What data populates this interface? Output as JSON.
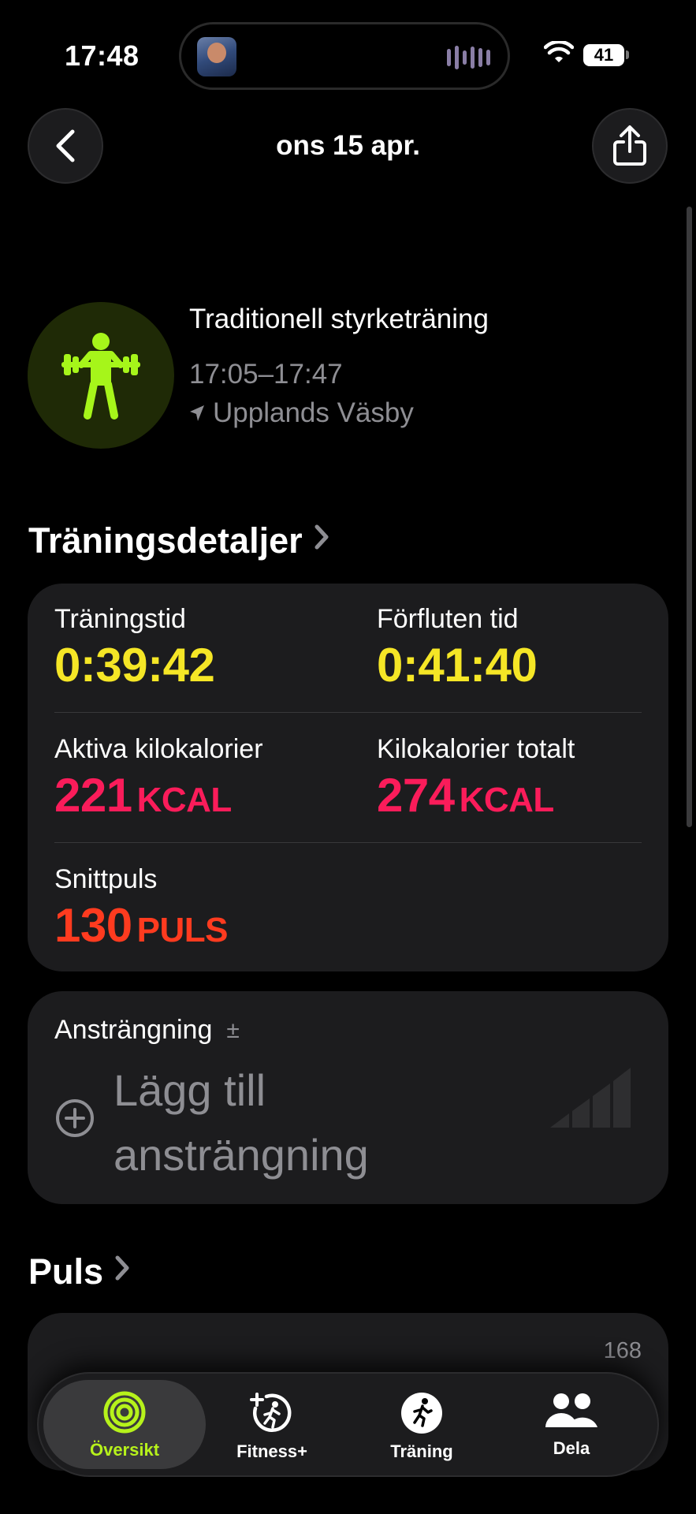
{
  "status_bar": {
    "time": "17:48",
    "battery": "41"
  },
  "nav": {
    "title": "ons 15 apr."
  },
  "workout": {
    "name": "Traditionell styrketräning",
    "time_range": "17:05–17:47",
    "location": "Upplands Väsby"
  },
  "details": {
    "title": "Träningsdetaljer",
    "metrics": [
      {
        "label": "Träningstid",
        "value": "0:39:42",
        "unit": ""
      },
      {
        "label": "Förfluten tid",
        "value": "0:41:40",
        "unit": ""
      },
      {
        "label": "Aktiva kilokalorier",
        "value": "221",
        "unit": "KCAL"
      },
      {
        "label": "Kilokalorier totalt",
        "value": "274",
        "unit": "KCAL"
      },
      {
        "label": "Snittpuls",
        "value": "130",
        "unit": "PULS"
      }
    ]
  },
  "effort": {
    "label": "Ansträngning",
    "pm": "±",
    "add_line1": "Lägg till",
    "add_line2": "ansträngning"
  },
  "pulse": {
    "title": "Puls",
    "max_value": "168"
  },
  "tabbar": {
    "items": [
      {
        "label": "Översikt",
        "icon": "rings-icon",
        "active": true
      },
      {
        "label": "Fitness+",
        "icon": "fitness-plus-icon",
        "active": false
      },
      {
        "label": "Träning",
        "icon": "running-icon",
        "active": false
      },
      {
        "label": "Dela",
        "icon": "people-icon",
        "active": false
      }
    ]
  },
  "colors": {
    "accent_green": "#b6f21b",
    "yellow": "#f5e626",
    "pink": "#fa1c5a",
    "red": "#ff3b1f"
  }
}
